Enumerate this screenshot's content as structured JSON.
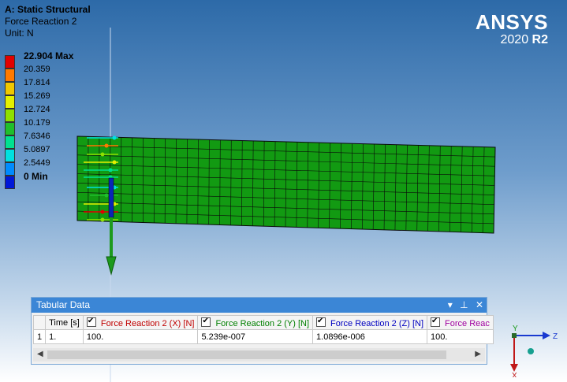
{
  "header": {
    "analysis": "A: Static Structural",
    "result": "Force Reaction 2",
    "unit": "Unit: N"
  },
  "logo": {
    "brand": "ANSYS",
    "version": "2020",
    "release": "R2"
  },
  "legend": [
    {
      "label": "22.904 Max",
      "color": "#e10000",
      "bold": true
    },
    {
      "label": "20.359",
      "color": "#ff7a00"
    },
    {
      "label": "17.814",
      "color": "#f0c800"
    },
    {
      "label": "15.269",
      "color": "#e4f000"
    },
    {
      "label": "12.724",
      "color": "#8ee000"
    },
    {
      "label": "10.179",
      "color": "#1fbf2c"
    },
    {
      "label": "7.6346",
      "color": "#00e090"
    },
    {
      "label": "5.0897",
      "color": "#00e0e0"
    },
    {
      "label": "2.5449",
      "color": "#008cff"
    },
    {
      "label": "0 Min",
      "color": "#0018d8",
      "bold": true
    }
  ],
  "colors": {
    "mesh": "#129a12",
    "mesh_line": "#0a0a0a",
    "probe": "#0a25b8",
    "arrow": "#1d9a1d"
  },
  "tabular": {
    "title": "Tabular Data",
    "buttons": {
      "dropdown": "▾",
      "pin": "⊥",
      "close": "✕"
    },
    "headers": [
      {
        "label": "Time [s]",
        "color": "#000000",
        "checked": false
      },
      {
        "label": "Force Reaction 2 (X) [N]",
        "color": "#c00000",
        "checked": true
      },
      {
        "label": "Force Reaction 2 (Y) [N]",
        "color": "#008000",
        "checked": true
      },
      {
        "label": "Force Reaction 2 (Z) [N]",
        "color": "#0000c0",
        "checked": true
      },
      {
        "label": "Force Reac",
        "color": "#a000a0",
        "checked": true
      }
    ],
    "rows": [
      [
        "1",
        "1.",
        "100.",
        "5.239e-007",
        "1.0896e-006",
        "100."
      ]
    ]
  },
  "triad": {
    "y": "Y",
    "z": "Z",
    "x": "X"
  }
}
